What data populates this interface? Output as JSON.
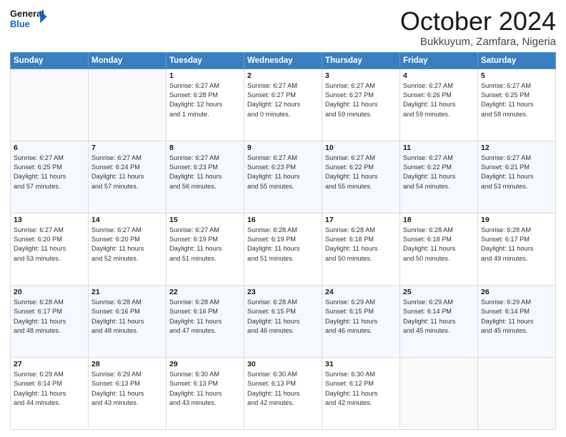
{
  "logo": {
    "line1": "General",
    "line2": "Blue"
  },
  "header": {
    "title": "October 2024",
    "subtitle": "Bukkuyum, Zamfara, Nigeria"
  },
  "weekdays": [
    "Sunday",
    "Monday",
    "Tuesday",
    "Wednesday",
    "Thursday",
    "Friday",
    "Saturday"
  ],
  "weeks": [
    [
      {
        "day": "",
        "info": ""
      },
      {
        "day": "",
        "info": ""
      },
      {
        "day": "1",
        "info": "Sunrise: 6:27 AM\nSunset: 6:28 PM\nDaylight: 12 hours\nand 1 minute."
      },
      {
        "day": "2",
        "info": "Sunrise: 6:27 AM\nSunset: 6:27 PM\nDaylight: 12 hours\nand 0 minutes."
      },
      {
        "day": "3",
        "info": "Sunrise: 6:27 AM\nSunset: 6:27 PM\nDaylight: 11 hours\nand 59 minutes."
      },
      {
        "day": "4",
        "info": "Sunrise: 6:27 AM\nSunset: 6:26 PM\nDaylight: 11 hours\nand 59 minutes."
      },
      {
        "day": "5",
        "info": "Sunrise: 6:27 AM\nSunset: 6:25 PM\nDaylight: 11 hours\nand 58 minutes."
      }
    ],
    [
      {
        "day": "6",
        "info": "Sunrise: 6:27 AM\nSunset: 6:25 PM\nDaylight: 11 hours\nand 57 minutes."
      },
      {
        "day": "7",
        "info": "Sunrise: 6:27 AM\nSunset: 6:24 PM\nDaylight: 11 hours\nand 57 minutes."
      },
      {
        "day": "8",
        "info": "Sunrise: 6:27 AM\nSunset: 6:23 PM\nDaylight: 11 hours\nand 56 minutes."
      },
      {
        "day": "9",
        "info": "Sunrise: 6:27 AM\nSunset: 6:23 PM\nDaylight: 11 hours\nand 55 minutes."
      },
      {
        "day": "10",
        "info": "Sunrise: 6:27 AM\nSunset: 6:22 PM\nDaylight: 11 hours\nand 55 minutes."
      },
      {
        "day": "11",
        "info": "Sunrise: 6:27 AM\nSunset: 6:22 PM\nDaylight: 11 hours\nand 54 minutes."
      },
      {
        "day": "12",
        "info": "Sunrise: 6:27 AM\nSunset: 6:21 PM\nDaylight: 11 hours\nand 53 minutes."
      }
    ],
    [
      {
        "day": "13",
        "info": "Sunrise: 6:27 AM\nSunset: 6:20 PM\nDaylight: 11 hours\nand 53 minutes."
      },
      {
        "day": "14",
        "info": "Sunrise: 6:27 AM\nSunset: 6:20 PM\nDaylight: 11 hours\nand 52 minutes."
      },
      {
        "day": "15",
        "info": "Sunrise: 6:27 AM\nSunset: 6:19 PM\nDaylight: 11 hours\nand 51 minutes."
      },
      {
        "day": "16",
        "info": "Sunrise: 6:28 AM\nSunset: 6:19 PM\nDaylight: 11 hours\nand 51 minutes."
      },
      {
        "day": "17",
        "info": "Sunrise: 6:28 AM\nSunset: 6:18 PM\nDaylight: 11 hours\nand 50 minutes."
      },
      {
        "day": "18",
        "info": "Sunrise: 6:28 AM\nSunset: 6:18 PM\nDaylight: 11 hours\nand 50 minutes."
      },
      {
        "day": "19",
        "info": "Sunrise: 6:28 AM\nSunset: 6:17 PM\nDaylight: 11 hours\nand 49 minutes."
      }
    ],
    [
      {
        "day": "20",
        "info": "Sunrise: 6:28 AM\nSunset: 6:17 PM\nDaylight: 11 hours\nand 48 minutes."
      },
      {
        "day": "21",
        "info": "Sunrise: 6:28 AM\nSunset: 6:16 PM\nDaylight: 11 hours\nand 48 minutes."
      },
      {
        "day": "22",
        "info": "Sunrise: 6:28 AM\nSunset: 6:16 PM\nDaylight: 11 hours\nand 47 minutes."
      },
      {
        "day": "23",
        "info": "Sunrise: 6:28 AM\nSunset: 6:15 PM\nDaylight: 11 hours\nand 46 minutes."
      },
      {
        "day": "24",
        "info": "Sunrise: 6:29 AM\nSunset: 6:15 PM\nDaylight: 11 hours\nand 46 minutes."
      },
      {
        "day": "25",
        "info": "Sunrise: 6:29 AM\nSunset: 6:14 PM\nDaylight: 11 hours\nand 45 minutes."
      },
      {
        "day": "26",
        "info": "Sunrise: 6:29 AM\nSunset: 6:14 PM\nDaylight: 11 hours\nand 45 minutes."
      }
    ],
    [
      {
        "day": "27",
        "info": "Sunrise: 6:29 AM\nSunset: 6:14 PM\nDaylight: 11 hours\nand 44 minutes."
      },
      {
        "day": "28",
        "info": "Sunrise: 6:29 AM\nSunset: 6:13 PM\nDaylight: 11 hours\nand 43 minutes."
      },
      {
        "day": "29",
        "info": "Sunrise: 6:30 AM\nSunset: 6:13 PM\nDaylight: 11 hours\nand 43 minutes."
      },
      {
        "day": "30",
        "info": "Sunrise: 6:30 AM\nSunset: 6:13 PM\nDaylight: 11 hours\nand 42 minutes."
      },
      {
        "day": "31",
        "info": "Sunrise: 6:30 AM\nSunset: 6:12 PM\nDaylight: 11 hours\nand 42 minutes."
      },
      {
        "day": "",
        "info": ""
      },
      {
        "day": "",
        "info": ""
      }
    ]
  ]
}
